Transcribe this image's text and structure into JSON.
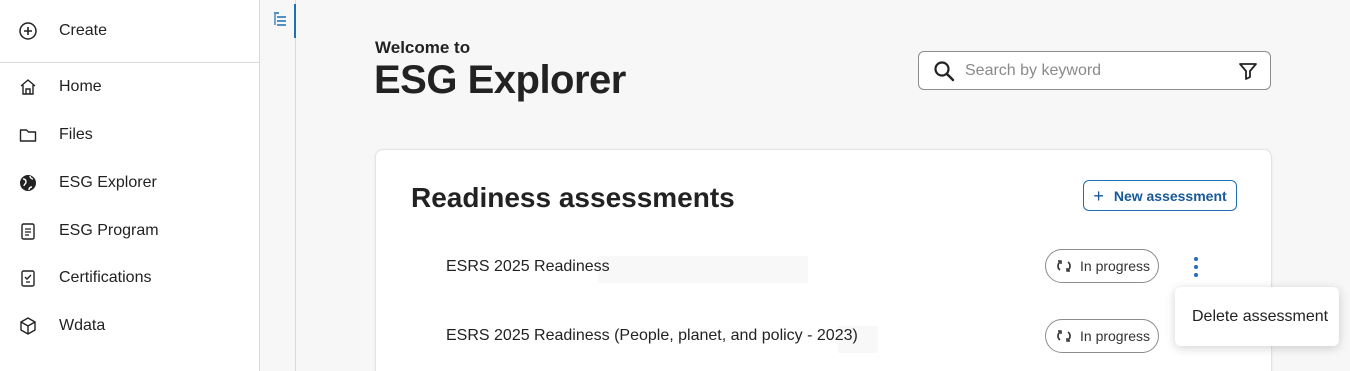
{
  "colors": {
    "accent": "#1f6fb5",
    "sidebar_bg": "#ffffff",
    "page_bg": "#f7f7f7"
  },
  "sidebar": {
    "create": {
      "label": "Create",
      "icon": "plus-circle-icon"
    },
    "items": [
      {
        "label": "Home",
        "icon": "home-icon"
      },
      {
        "label": "Files",
        "icon": "folder-icon"
      },
      {
        "label": "ESG Explorer",
        "icon": "globe-icon"
      },
      {
        "label": "ESG Program",
        "icon": "clipboard-icon"
      },
      {
        "label": "Certifications",
        "icon": "certificate-icon"
      },
      {
        "label": "Wdata",
        "icon": "cube-icon"
      }
    ]
  },
  "rail": {
    "toggle_icon": "outline-toggle-icon"
  },
  "header": {
    "welcome": "Welcome to",
    "title": "ESG Explorer"
  },
  "search": {
    "placeholder": "Search by keyword",
    "value": "",
    "icon": "search-icon",
    "filter_icon": "filter-icon"
  },
  "card": {
    "title": "Readiness assessments",
    "new_button": {
      "label": "New assessment",
      "icon": "plus-icon"
    },
    "rows": [
      {
        "name": "ESRS 2025 Readiness",
        "status": "In progress",
        "status_icon": "sync-icon"
      },
      {
        "name": "ESRS 2025 Readiness (People, planet, and policy - 2023)",
        "status": "In progress",
        "status_icon": "sync-icon"
      }
    ],
    "more_icon": "kebab-icon"
  },
  "menu": {
    "items": [
      {
        "label": "Delete assessment"
      }
    ]
  }
}
